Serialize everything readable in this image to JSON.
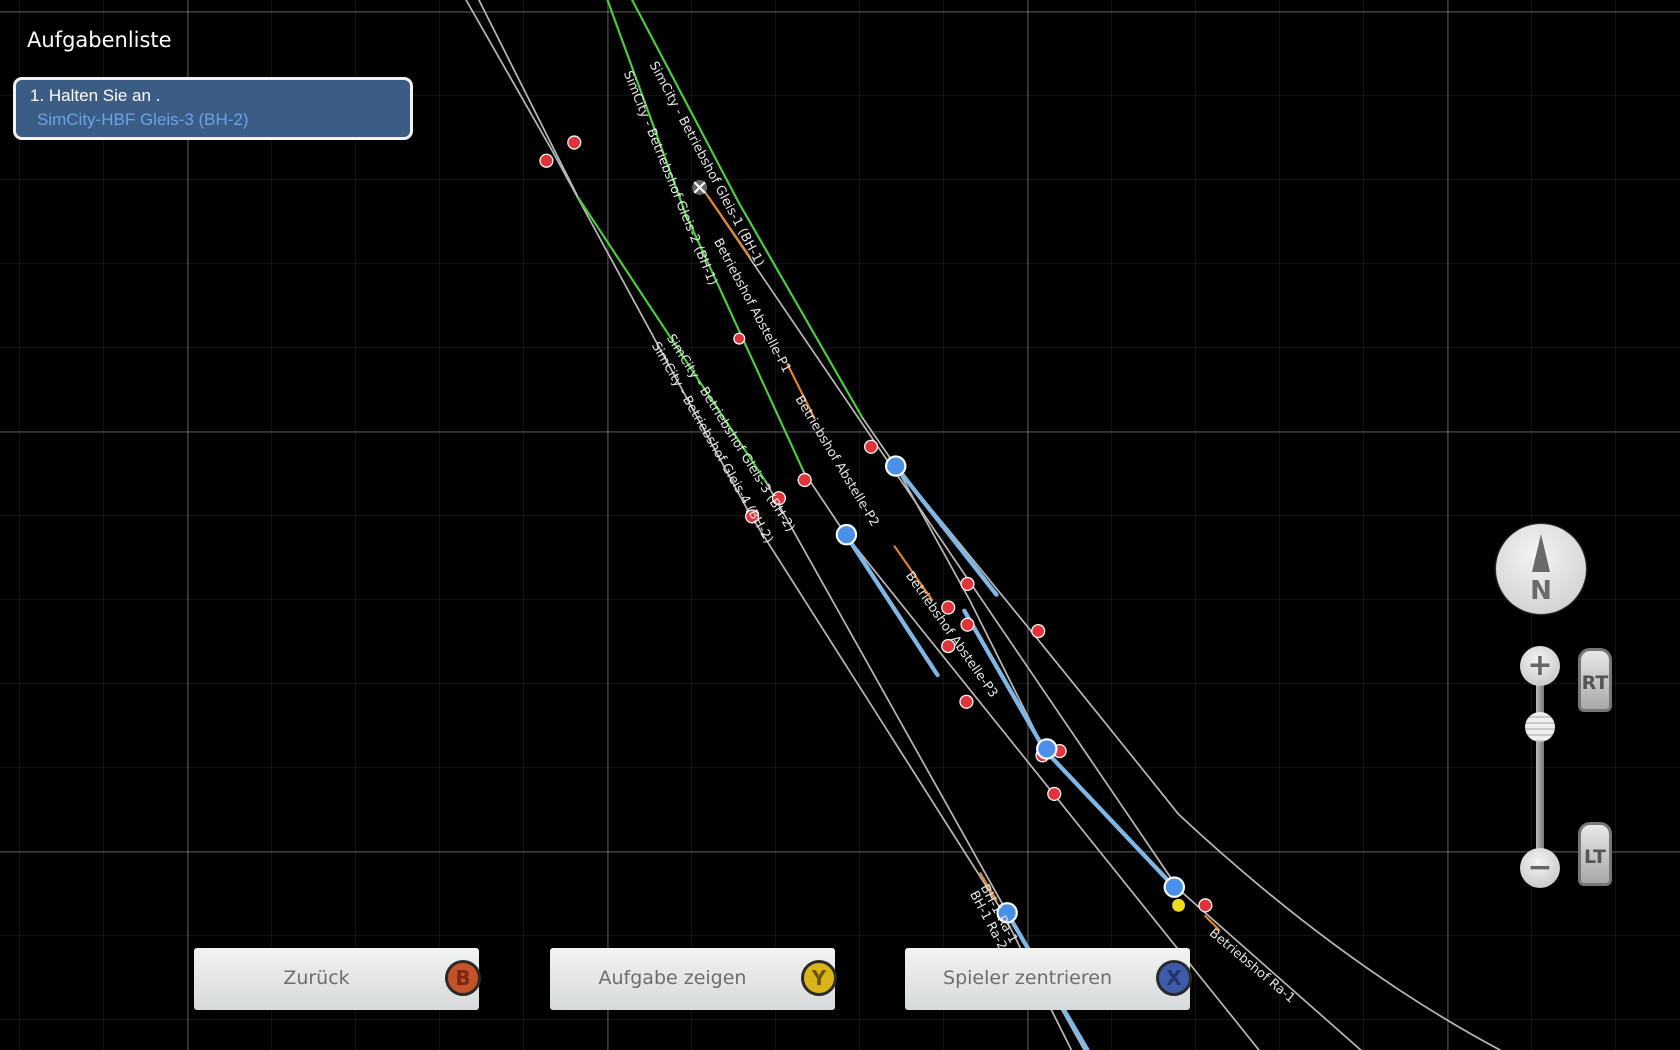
{
  "tasklist": {
    "title": "Aufgabenliste",
    "tasks": [
      {
        "line1": "1. Halten Sie an  .",
        "line2": "SimCity-HBF Gleis-3 (BH-2)"
      }
    ]
  },
  "map": {
    "track_labels": {
      "gleis1": "SimCity - Betriebshof Gleis-1 (BH-1)",
      "gleis2": "SimCity - Betriebshof Gleis-2 (BH-1)",
      "gleis3": "SimCity - Betriebshof Gleis-3 (BH-2)",
      "gleis4": "SimCity - Betriebshof Gleis-4 (BH-2)",
      "abstelle_p1": "Betriebshof Abstelle-P1",
      "abstelle_p2": "Betriebshof Abstelle-P2",
      "abstelle_p3": "Betriebshof Abstelle-P3",
      "bh1_ra1": "BH-1 Ra-1",
      "bh1_ra2": "BH-1 Ra-2",
      "betriebshof_ra1": "Betriebshof Ra-1"
    },
    "colors": {
      "active_track": "#49d13a",
      "route": "#7fb8e6",
      "node": "#4a90e8",
      "signal": "#e0333a",
      "section": "#e3862b",
      "track": "#b8b8b8"
    }
  },
  "buttons": {
    "back": {
      "label": "Zurück",
      "key": "B",
      "color": "#c4532a"
    },
    "show_task": {
      "label": "Aufgabe zeigen",
      "key": "Y",
      "color": "#d9b418"
    },
    "center_player": {
      "label": "Spieler zentrieren",
      "key": "X",
      "color": "#3e5aa8"
    }
  },
  "controls": {
    "compass_label": "N",
    "zoom_in": "+",
    "zoom_out": "−",
    "zoom_in_trigger": "RT",
    "zoom_out_trigger": "LT",
    "zoom_level_fraction": 0.3
  }
}
